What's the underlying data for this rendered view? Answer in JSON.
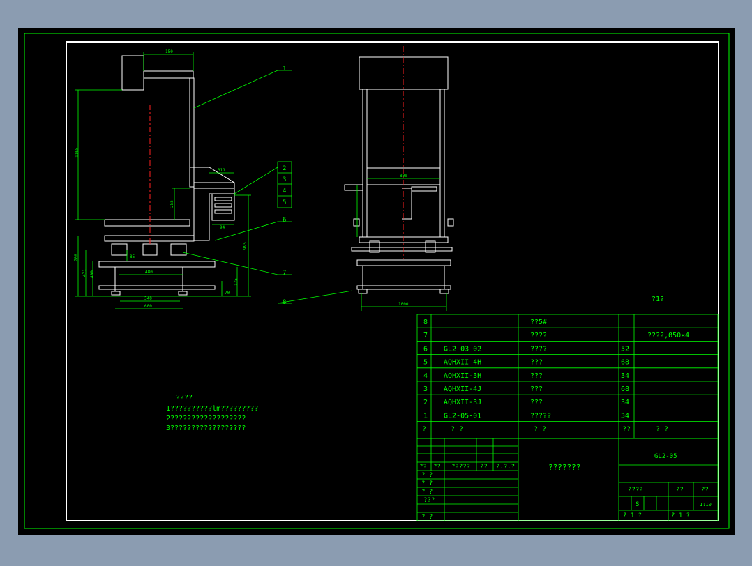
{
  "colors": {
    "background": "#8b9cb1",
    "sheet": "#000000",
    "line": "#00ff00",
    "frame": "#ffffff",
    "centerline": "#ff2020",
    "detail": "#ffffff"
  },
  "drawing": {
    "side_view_dims": {
      "d150": "150",
      "d1165": "1165",
      "d311": "311",
      "d255": "255",
      "d94": "94",
      "d995": "995",
      "d85": "85",
      "d480": "480",
      "d780": "780",
      "d471": "471",
      "d400": "400",
      "d175": "175",
      "d70": "70",
      "d340": "340",
      "d600": "600"
    },
    "front_view_dims": {
      "d800": "800",
      "d1000": "1000"
    },
    "balloons": [
      "1",
      "2",
      "3",
      "4",
      "5",
      "6",
      "7",
      "8"
    ],
    "right_note": "?1?",
    "notes": {
      "title": "????",
      "line1": "1??????????lm?????????",
      "line2": "2??????????????????",
      "line3": "3??????????????????"
    }
  },
  "bom": {
    "rows": [
      {
        "no": "8",
        "code": "",
        "name": "??5#",
        "qty": "",
        "remark": ""
      },
      {
        "no": "7",
        "code": "",
        "name": "????",
        "qty": "",
        "remark": "????,Ø50×4"
      },
      {
        "no": "6",
        "code": "GL2-03-02",
        "name": "????",
        "qty": "52",
        "remark": ""
      },
      {
        "no": "5",
        "code": "AQHXII-4H",
        "name": "???",
        "qty": "68",
        "remark": ""
      },
      {
        "no": "4",
        "code": "AQHXII-3H",
        "name": "???",
        "qty": "34",
        "remark": ""
      },
      {
        "no": "3",
        "code": "AQHXII-4J",
        "name": "???",
        "qty": "68",
        "remark": ""
      },
      {
        "no": "2",
        "code": "AQHXII-3J",
        "name": "???",
        "qty": "34",
        "remark": ""
      },
      {
        "no": "1",
        "code": "GL2-05-01",
        "name": "?????",
        "qty": "34",
        "remark": ""
      }
    ],
    "header": {
      "no": "?",
      "code": "?  ?",
      "name": "?  ?",
      "qty": "??",
      "remark": "?  ?"
    }
  },
  "title_block": {
    "rev_headers": [
      "??",
      "??",
      "?????",
      "??",
      "?.?.?"
    ],
    "roles": [
      "? ?",
      "? ?",
      "? ?",
      "???",
      "? ?"
    ],
    "drawing_name": "???????",
    "drawing_number": "GL2-05",
    "stage_label": "????",
    "weight_label": "??",
    "scale_label": "??",
    "stage_value": "S",
    "scale_value": "1:10",
    "sheet_total": "? 1 ?",
    "sheet_no": "? 1 ?"
  }
}
